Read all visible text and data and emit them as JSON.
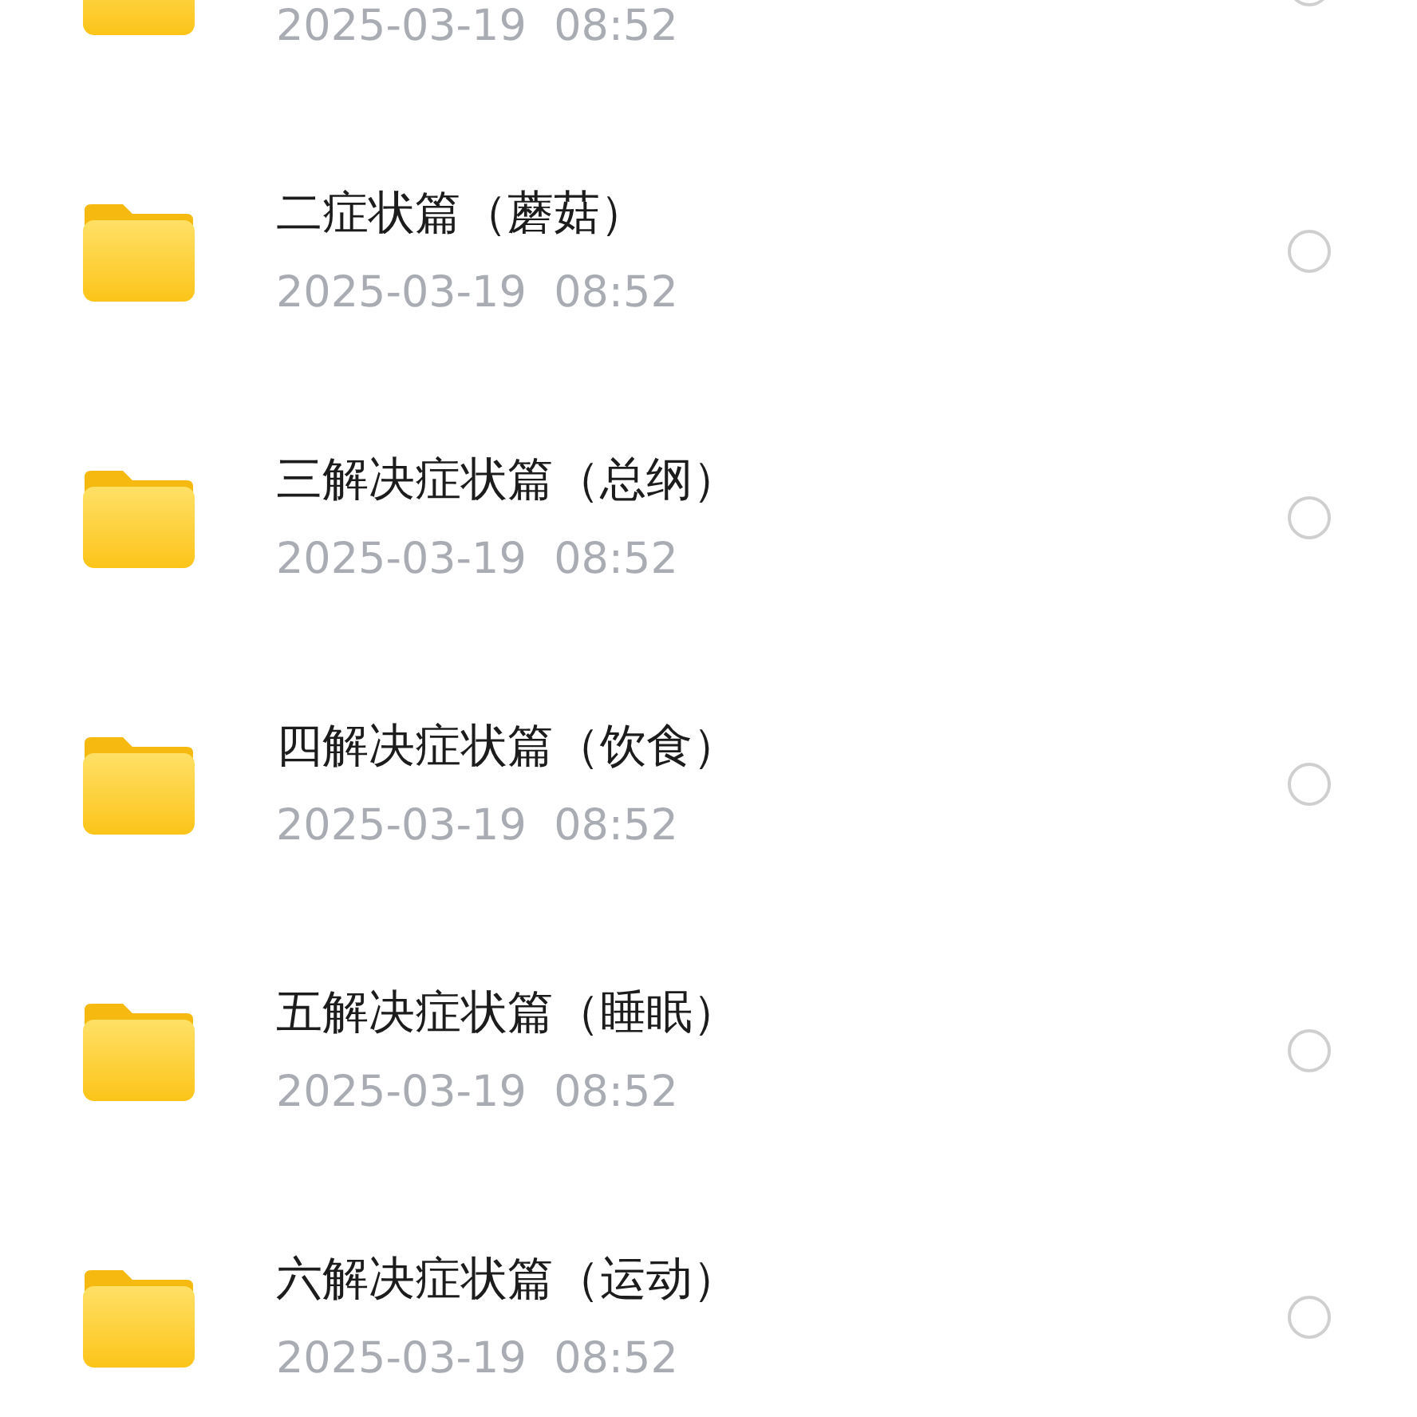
{
  "files": [
    {
      "date": "2025-03-19  08:52",
      "selected": false
    },
    {
      "name": "二症状篇（蘑菇）",
      "date": "2025-03-19  08:52",
      "selected": false
    },
    {
      "name": "三解决症状篇（总纲）",
      "date": "2025-03-19  08:52",
      "selected": false
    },
    {
      "name": "四解决症状篇（饮食）",
      "date": "2025-03-19  08:52",
      "selected": false
    },
    {
      "name": "五解决症状篇（睡眠）",
      "date": "2025-03-19  08:52",
      "selected": false
    },
    {
      "name": "六解决症状篇（运动）",
      "date": "2025-03-19  08:52",
      "selected": false
    }
  ]
}
